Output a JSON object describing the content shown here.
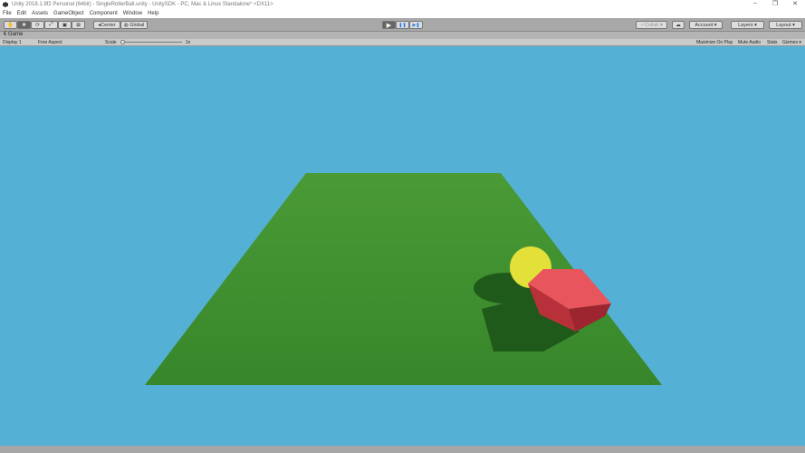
{
  "window": {
    "title": "Unity 2018.1.9f2 Personal (64bit) - SingleRollerBall.unity - UnitySDK - PC, Mac & Linux Standalone* <DX11>",
    "controls": [
      "–",
      "❐",
      "✕"
    ]
  },
  "menu": [
    "File",
    "Edit",
    "Assets",
    "GameObject",
    "Component",
    "Window",
    "Help"
  ],
  "toolbar": {
    "tools": [
      "hand-tool",
      "move-tool",
      "rotate-tool",
      "scale-tool",
      "rect-tool",
      "transform-tool"
    ],
    "tool_glyphs": [
      "✋",
      "✥",
      "⟳",
      "⤢",
      "▣",
      "⊠"
    ],
    "pivot": "◂Center",
    "space": "◍ Global",
    "play": "▶",
    "pause": "❚❚",
    "step": "▶❚",
    "collab": "✓Collab ▾",
    "cloud": "☁",
    "account": "Account ▾",
    "layers": "Layers ▾",
    "layout": "Layout ▾"
  },
  "game": {
    "tab": "€ Game",
    "display": "Display 1",
    "aspect": "Free Aspect",
    "scale_label": "Scale",
    "scale_value": "1x",
    "maximize": "Maximize On Play",
    "mute": "Mute Audio",
    "stats": "Stats",
    "gizmos": "Gizmos ▾"
  },
  "colors": {
    "sky": "#55b0d5",
    "ground": "#3c8a2c",
    "ball": "#e3e03a",
    "cube": "#d8424d"
  }
}
